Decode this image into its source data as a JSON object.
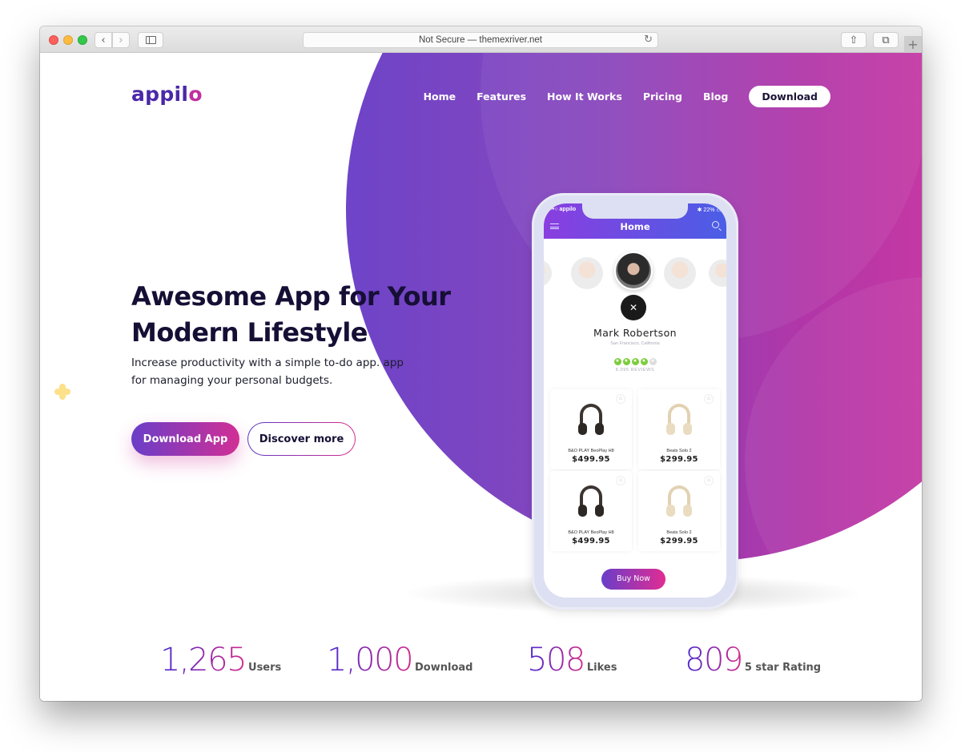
{
  "browser": {
    "url_text": "Not Secure — themexriver.net",
    "back_icon": "‹",
    "forward_icon": "›",
    "reload_icon": "↻",
    "share_icon": "⇧",
    "tabs_icon": "⧉",
    "new_tab_icon": "+"
  },
  "site": {
    "logo_main": "appil",
    "logo_accent": "o",
    "nav": [
      {
        "label": "Home"
      },
      {
        "label": "Features"
      },
      {
        "label": "How It Works"
      },
      {
        "label": "Pricing"
      },
      {
        "label": "Blog"
      }
    ],
    "nav_cta": "Download",
    "hero": {
      "title": "Awesome App for Your Modern Lifestyle",
      "subtitle": "Increase productivity with a simple to-do app. app for managing your personal budgets.",
      "primary_button": "Download App",
      "secondary_button": "Discover more"
    },
    "colors": {
      "brand_purple": "#4a28a8",
      "brand_pink": "#c02fa0",
      "gradient_start": "#6e44c8",
      "gradient_end": "#d83a9f",
      "rating_green": "#7ccc3c"
    }
  },
  "phone": {
    "status_left": "•••○ appilo",
    "status_right": "✱ 22% ▭",
    "screen_title": "Home",
    "profile_name": "Mark Robertson",
    "profile_location": "San Francisco, California",
    "close_icon": "✕",
    "rating": {
      "stars": 4,
      "max": 5,
      "reviews": "8,095 REVIEWS"
    },
    "products": [
      {
        "name": "B&O PLAY BeoPlay H8",
        "price": "$499.95",
        "style": "dark"
      },
      {
        "name": "Beats Solo 2",
        "price": "$299.95",
        "style": "light"
      },
      {
        "name": "B&O PLAY BeoPlay H8",
        "price": "$499.95",
        "style": "dark"
      },
      {
        "name": "Beats Solo 2",
        "price": "$299.95",
        "style": "light"
      }
    ],
    "cart_icon": "⌂",
    "buy_button": "Buy Now"
  },
  "stats": [
    {
      "value": "1,265",
      "label": "Users"
    },
    {
      "value": "1,000",
      "label": "Download"
    },
    {
      "value": "508",
      "label": "Likes"
    },
    {
      "value": "809",
      "label": "5 star Rating"
    }
  ]
}
